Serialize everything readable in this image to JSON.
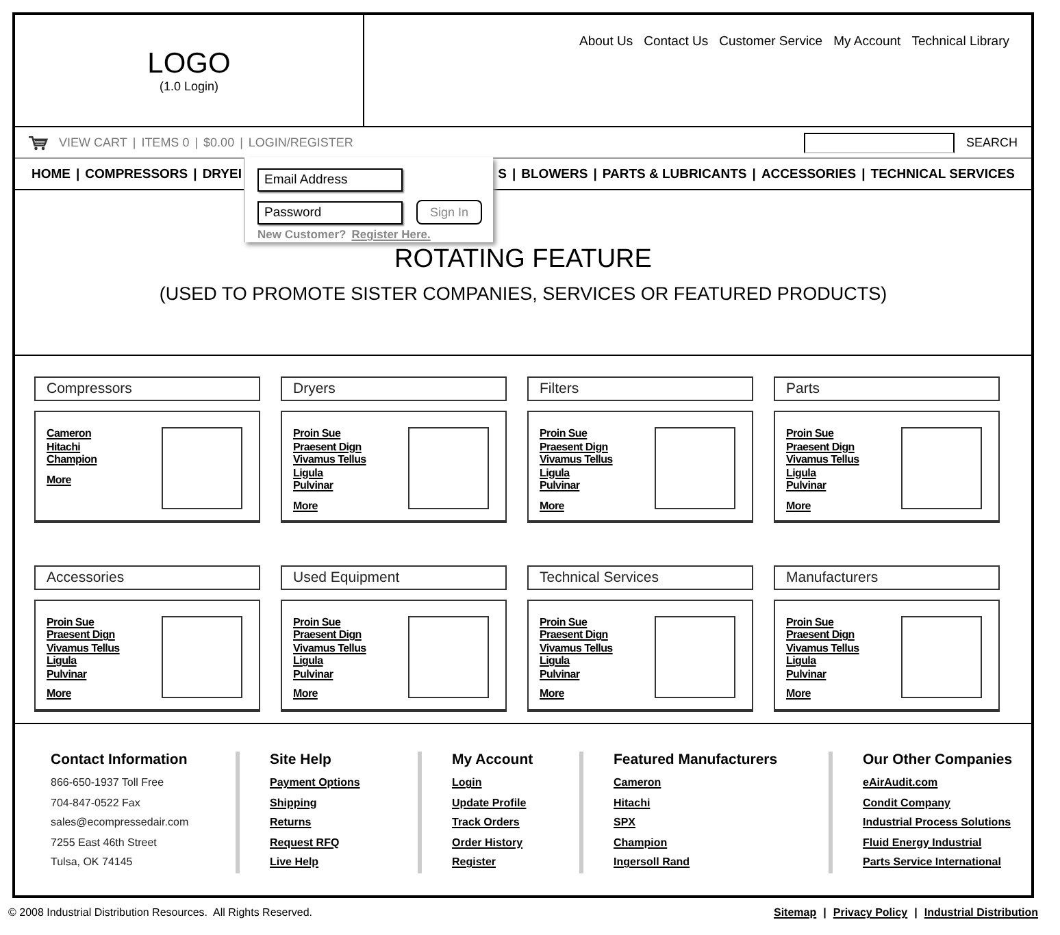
{
  "logo": {
    "text": "LOGO",
    "caption": "(1.0 Login)"
  },
  "top_links": [
    "About Us",
    "Contact Us",
    "Customer Service",
    "My Account",
    "Technical Library"
  ],
  "utility_bar": {
    "separator": "|",
    "items": [
      "VIEW CART",
      "ITEMS 0",
      "$0.00",
      "LOGIN/REGISTER"
    ]
  },
  "search": {
    "button": "SEARCH"
  },
  "nav": {
    "separator": "|",
    "left": [
      "HOME",
      "COMPRESSORS",
      "DRYEI"
    ],
    "right": [
      "S",
      "BLOWERS",
      "PARTS & LUBRICANTS",
      "ACCESSORIES",
      "TECHNICAL SERVICES"
    ]
  },
  "login_popup": {
    "email": {
      "placeholder": "Email Address"
    },
    "password": {
      "placeholder": "Password"
    },
    "button": "Sign In",
    "prompt": "New Customer?",
    "link": "Register Here."
  },
  "feature": {
    "title": "ROTATING FEATURE",
    "subtitle": "(USED TO PROMOTE SISTER COMPANIES, SERVICES OR FEATURED PRODUCTS)"
  },
  "categories": [
    {
      "title": "Compressors",
      "links": [
        "Cameron",
        "Hitachi",
        "Champion"
      ],
      "more": "More"
    },
    {
      "title": "Dryers",
      "links": [
        "Proin Sue",
        "Praesent Dign",
        "Vivamus Tellus",
        "Ligula",
        "Pulvinar"
      ],
      "more": "More"
    },
    {
      "title": "Filters",
      "links": [
        "Proin Sue",
        "Praesent Dign",
        "Vivamus Tellus",
        "Ligula",
        "Pulvinar"
      ],
      "more": "More"
    },
    {
      "title": "Parts",
      "links": [
        "Proin Sue",
        "Praesent Dign",
        "Vivamus Tellus",
        "Ligula",
        "Pulvinar"
      ],
      "more": "More"
    },
    {
      "title": "Accessories",
      "links": [
        "Proin Sue",
        "Praesent Dign",
        "Vivamus Tellus",
        "Ligula",
        "Pulvinar"
      ],
      "more": "More"
    },
    {
      "title": "Used Equipment",
      "links": [
        "Proin Sue",
        "Praesent Dign",
        "Vivamus Tellus",
        "Ligula",
        "Pulvinar"
      ],
      "more": "More"
    },
    {
      "title": "Technical Services",
      "links": [
        "Proin Sue",
        "Praesent Dign",
        "Vivamus Tellus",
        "Ligula",
        "Pulvinar"
      ],
      "more": "More"
    },
    {
      "title": "Manufacturers",
      "links": [
        "Proin Sue",
        "Praesent Dign",
        "Vivamus Tellus",
        "Ligula",
        "Pulvinar"
      ],
      "more": "More"
    }
  ],
  "footer": [
    {
      "heading": "Contact Information",
      "kind": "text",
      "items": [
        "866-650-1937 Toll Free",
        "704-847-0522 Fax",
        "sales@ecompressedair.com",
        "7255 East 46th Street",
        "Tulsa, OK 74145"
      ]
    },
    {
      "heading": "Site Help",
      "kind": "links",
      "items": [
        "Payment Options",
        "Shipping",
        "Returns",
        "Request RFQ",
        "Live Help"
      ]
    },
    {
      "heading": "My Account",
      "kind": "links",
      "items": [
        "Login",
        "Update Profile",
        "Track Orders",
        "Order History",
        "Register"
      ]
    },
    {
      "heading": "Featured Manufacturers",
      "kind": "links",
      "items": [
        "Cameron",
        "Hitachi",
        "SPX",
        "Champion",
        "Ingersoll Rand"
      ]
    },
    {
      "heading": "Our Other Companies",
      "kind": "links",
      "items": [
        "eAirAudit.com",
        "Condit Company",
        "Industrial Process Solutions",
        "Fluid Energy Industrial",
        "Parts Service International"
      ]
    }
  ],
  "copyright": "© 2008 Industrial Distribution Resources.  All Rights Reserved.",
  "bottom_links": {
    "separator": "|",
    "items": [
      "Sitemap",
      "Privacy Policy",
      "Industrial Distribution"
    ]
  }
}
